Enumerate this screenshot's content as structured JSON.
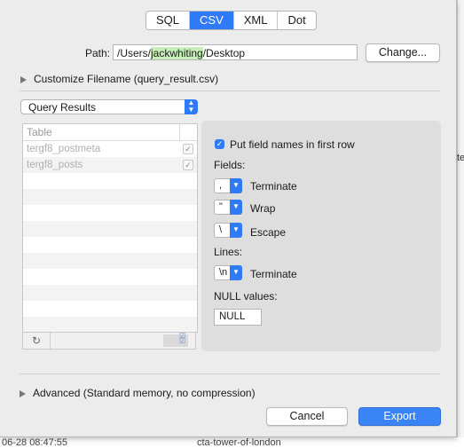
{
  "tabs": [
    "SQL",
    "CSV",
    "XML",
    "Dot"
  ],
  "selected_tab": "CSV",
  "path": {
    "label": "Path:",
    "prefix": "/Users/",
    "highlight": "jackwhiting",
    "suffix": "/Desktop",
    "change_label": "Change..."
  },
  "customize_label": "Customize Filename (query_result.csv)",
  "source_popup": "Query Results",
  "table": {
    "header": "Table",
    "rows": [
      {
        "name": "tergf8_postmeta",
        "checked": true
      },
      {
        "name": "tergf8_posts",
        "checked": true
      }
    ]
  },
  "options": {
    "field_names_label": "Put field names in first row",
    "fields_label": "Fields:",
    "terminate_value": ",",
    "terminate_label": "Terminate",
    "wrap_value": "\"",
    "wrap_label": "Wrap",
    "escape_value": "\\",
    "escape_label": "Escape",
    "lines_label": "Lines:",
    "line_terminate_value": "\\n",
    "line_terminate_label": "Terminate",
    "null_label": "NULL values:",
    "null_value": "NULL"
  },
  "advanced_label": "Advanced (Standard memory, no compression)",
  "cancel_label": "Cancel",
  "export_label": "Export",
  "background": {
    "edge_text": "te",
    "bottom_left": "06-28 08:47:55",
    "bottom_right": "cta-tower-of-london"
  },
  "colors": {
    "accent": "#2f7bf5",
    "path_highlight": "#c6f0b8"
  }
}
